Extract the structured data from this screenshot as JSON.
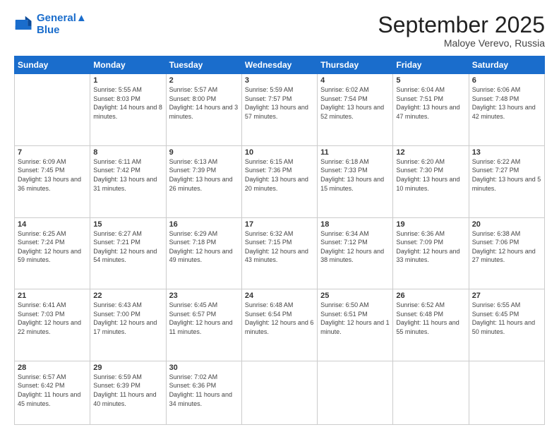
{
  "header": {
    "logo_line1": "General",
    "logo_line2": "Blue",
    "month": "September 2025",
    "location": "Maloye Verevo, Russia"
  },
  "weekdays": [
    "Sunday",
    "Monday",
    "Tuesday",
    "Wednesday",
    "Thursday",
    "Friday",
    "Saturday"
  ],
  "rows": [
    [
      {
        "day": "",
        "sunrise": "",
        "sunset": "",
        "daylight": ""
      },
      {
        "day": "1",
        "sunrise": "Sunrise: 5:55 AM",
        "sunset": "Sunset: 8:03 PM",
        "daylight": "Daylight: 14 hours and 8 minutes."
      },
      {
        "day": "2",
        "sunrise": "Sunrise: 5:57 AM",
        "sunset": "Sunset: 8:00 PM",
        "daylight": "Daylight: 14 hours and 3 minutes."
      },
      {
        "day": "3",
        "sunrise": "Sunrise: 5:59 AM",
        "sunset": "Sunset: 7:57 PM",
        "daylight": "Daylight: 13 hours and 57 minutes."
      },
      {
        "day": "4",
        "sunrise": "Sunrise: 6:02 AM",
        "sunset": "Sunset: 7:54 PM",
        "daylight": "Daylight: 13 hours and 52 minutes."
      },
      {
        "day": "5",
        "sunrise": "Sunrise: 6:04 AM",
        "sunset": "Sunset: 7:51 PM",
        "daylight": "Daylight: 13 hours and 47 minutes."
      },
      {
        "day": "6",
        "sunrise": "Sunrise: 6:06 AM",
        "sunset": "Sunset: 7:48 PM",
        "daylight": "Daylight: 13 hours and 42 minutes."
      }
    ],
    [
      {
        "day": "7",
        "sunrise": "Sunrise: 6:09 AM",
        "sunset": "Sunset: 7:45 PM",
        "daylight": "Daylight: 13 hours and 36 minutes."
      },
      {
        "day": "8",
        "sunrise": "Sunrise: 6:11 AM",
        "sunset": "Sunset: 7:42 PM",
        "daylight": "Daylight: 13 hours and 31 minutes."
      },
      {
        "day": "9",
        "sunrise": "Sunrise: 6:13 AM",
        "sunset": "Sunset: 7:39 PM",
        "daylight": "Daylight: 13 hours and 26 minutes."
      },
      {
        "day": "10",
        "sunrise": "Sunrise: 6:15 AM",
        "sunset": "Sunset: 7:36 PM",
        "daylight": "Daylight: 13 hours and 20 minutes."
      },
      {
        "day": "11",
        "sunrise": "Sunrise: 6:18 AM",
        "sunset": "Sunset: 7:33 PM",
        "daylight": "Daylight: 13 hours and 15 minutes."
      },
      {
        "day": "12",
        "sunrise": "Sunrise: 6:20 AM",
        "sunset": "Sunset: 7:30 PM",
        "daylight": "Daylight: 13 hours and 10 minutes."
      },
      {
        "day": "13",
        "sunrise": "Sunrise: 6:22 AM",
        "sunset": "Sunset: 7:27 PM",
        "daylight": "Daylight: 13 hours and 5 minutes."
      }
    ],
    [
      {
        "day": "14",
        "sunrise": "Sunrise: 6:25 AM",
        "sunset": "Sunset: 7:24 PM",
        "daylight": "Daylight: 12 hours and 59 minutes."
      },
      {
        "day": "15",
        "sunrise": "Sunrise: 6:27 AM",
        "sunset": "Sunset: 7:21 PM",
        "daylight": "Daylight: 12 hours and 54 minutes."
      },
      {
        "day": "16",
        "sunrise": "Sunrise: 6:29 AM",
        "sunset": "Sunset: 7:18 PM",
        "daylight": "Daylight: 12 hours and 49 minutes."
      },
      {
        "day": "17",
        "sunrise": "Sunrise: 6:32 AM",
        "sunset": "Sunset: 7:15 PM",
        "daylight": "Daylight: 12 hours and 43 minutes."
      },
      {
        "day": "18",
        "sunrise": "Sunrise: 6:34 AM",
        "sunset": "Sunset: 7:12 PM",
        "daylight": "Daylight: 12 hours and 38 minutes."
      },
      {
        "day": "19",
        "sunrise": "Sunrise: 6:36 AM",
        "sunset": "Sunset: 7:09 PM",
        "daylight": "Daylight: 12 hours and 33 minutes."
      },
      {
        "day": "20",
        "sunrise": "Sunrise: 6:38 AM",
        "sunset": "Sunset: 7:06 PM",
        "daylight": "Daylight: 12 hours and 27 minutes."
      }
    ],
    [
      {
        "day": "21",
        "sunrise": "Sunrise: 6:41 AM",
        "sunset": "Sunset: 7:03 PM",
        "daylight": "Daylight: 12 hours and 22 minutes."
      },
      {
        "day": "22",
        "sunrise": "Sunrise: 6:43 AM",
        "sunset": "Sunset: 7:00 PM",
        "daylight": "Daylight: 12 hours and 17 minutes."
      },
      {
        "day": "23",
        "sunrise": "Sunrise: 6:45 AM",
        "sunset": "Sunset: 6:57 PM",
        "daylight": "Daylight: 12 hours and 11 minutes."
      },
      {
        "day": "24",
        "sunrise": "Sunrise: 6:48 AM",
        "sunset": "Sunset: 6:54 PM",
        "daylight": "Daylight: 12 hours and 6 minutes."
      },
      {
        "day": "25",
        "sunrise": "Sunrise: 6:50 AM",
        "sunset": "Sunset: 6:51 PM",
        "daylight": "Daylight: 12 hours and 1 minute."
      },
      {
        "day": "26",
        "sunrise": "Sunrise: 6:52 AM",
        "sunset": "Sunset: 6:48 PM",
        "daylight": "Daylight: 11 hours and 55 minutes."
      },
      {
        "day": "27",
        "sunrise": "Sunrise: 6:55 AM",
        "sunset": "Sunset: 6:45 PM",
        "daylight": "Daylight: 11 hours and 50 minutes."
      }
    ],
    [
      {
        "day": "28",
        "sunrise": "Sunrise: 6:57 AM",
        "sunset": "Sunset: 6:42 PM",
        "daylight": "Daylight: 11 hours and 45 minutes."
      },
      {
        "day": "29",
        "sunrise": "Sunrise: 6:59 AM",
        "sunset": "Sunset: 6:39 PM",
        "daylight": "Daylight: 11 hours and 40 minutes."
      },
      {
        "day": "30",
        "sunrise": "Sunrise: 7:02 AM",
        "sunset": "Sunset: 6:36 PM",
        "daylight": "Daylight: 11 hours and 34 minutes."
      },
      {
        "day": "",
        "sunrise": "",
        "sunset": "",
        "daylight": ""
      },
      {
        "day": "",
        "sunrise": "",
        "sunset": "",
        "daylight": ""
      },
      {
        "day": "",
        "sunrise": "",
        "sunset": "",
        "daylight": ""
      },
      {
        "day": "",
        "sunrise": "",
        "sunset": "",
        "daylight": ""
      }
    ]
  ]
}
